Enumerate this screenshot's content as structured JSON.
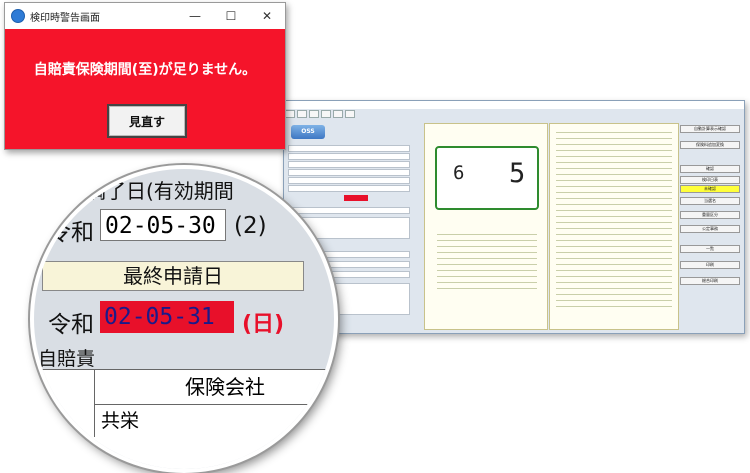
{
  "dialog": {
    "title": "検印時警告画面",
    "minimize": "—",
    "maximize": "☐",
    "close": "✕",
    "message": "自賠責保険期間(至)が足りません。",
    "button_label": "見直す",
    "background_color": "#f5142a"
  },
  "app": {
    "oss_label": "OSS",
    "plate_left": "6",
    "plate_right": "5",
    "buttons": [
      "自動計算表示確認",
      "保険料追加変換",
      "確認",
      "検印日表",
      "未確認",
      "当選名",
      "重量区分",
      "公定事務",
      "一覧",
      "印刷",
      "総合印刷"
    ],
    "sunday_label": "(日)"
  },
  "magnifier": {
    "header_text": "満了日(有効期間",
    "expiry_era": "令和",
    "expiry_date": "02-05-30",
    "expiry_suffix": "(2)",
    "last_apply_label": "最終申請日",
    "last_era": "令和",
    "last_date": "02-05-31",
    "last_day": "(日)",
    "jibaiseki_label": "自賠責",
    "insurer_header": "保険会社",
    "insurer_value": "共栄"
  }
}
